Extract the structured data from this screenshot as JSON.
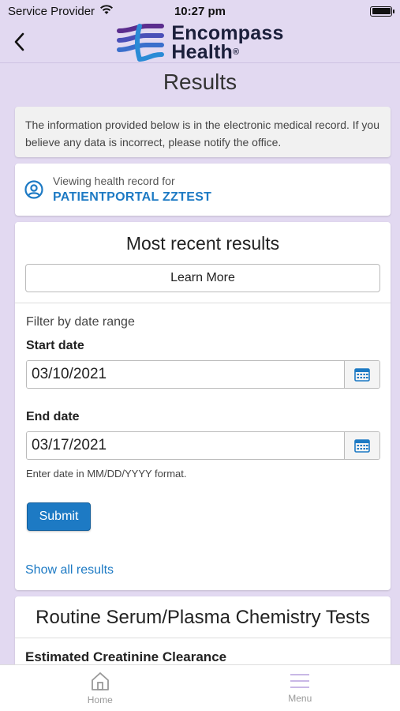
{
  "status_bar": {
    "carrier": "Service Provider",
    "time": "10:27 pm",
    "icons": [
      "wifi-icon",
      "battery-icon"
    ]
  },
  "header": {
    "logo_line1": "Encompass",
    "logo_line2": "Health",
    "logo_mark": "®",
    "back_icon": "chevron-left-icon"
  },
  "page": {
    "title": "Results"
  },
  "notice": {
    "text": "The information provided below is in the electronic medical record. If you believe any data is incorrect, please notify the office."
  },
  "viewing": {
    "label": "Viewing health record for",
    "patient_name": "PATIENTPORTAL ZZTEST",
    "icon": "user-circle-icon"
  },
  "results": {
    "title": "Most recent results",
    "learn_more_label": "Learn More",
    "filter_label": "Filter by date range",
    "start_label": "Start date",
    "start_value": "03/10/2021",
    "end_label": "End date",
    "end_value": "03/17/2021",
    "format_hint": "Enter date in MM/DD/YYYY format.",
    "submit_label": "Submit",
    "show_all_label": "Show all results"
  },
  "chemistry": {
    "title": "Routine Serum/Plasma Chemistry Tests",
    "first_test": "Estimated Creatinine Clearance"
  },
  "tabbar": {
    "tabs": [
      {
        "label": "Home",
        "icon": "home-icon"
      },
      {
        "label": "Menu",
        "icon": "menu-icon"
      }
    ]
  },
  "colors": {
    "background": "#e2d9f1",
    "accent": "#1d7ac4",
    "logo_purple": "#5b2d8e",
    "logo_blue": "#2a8bd6"
  }
}
